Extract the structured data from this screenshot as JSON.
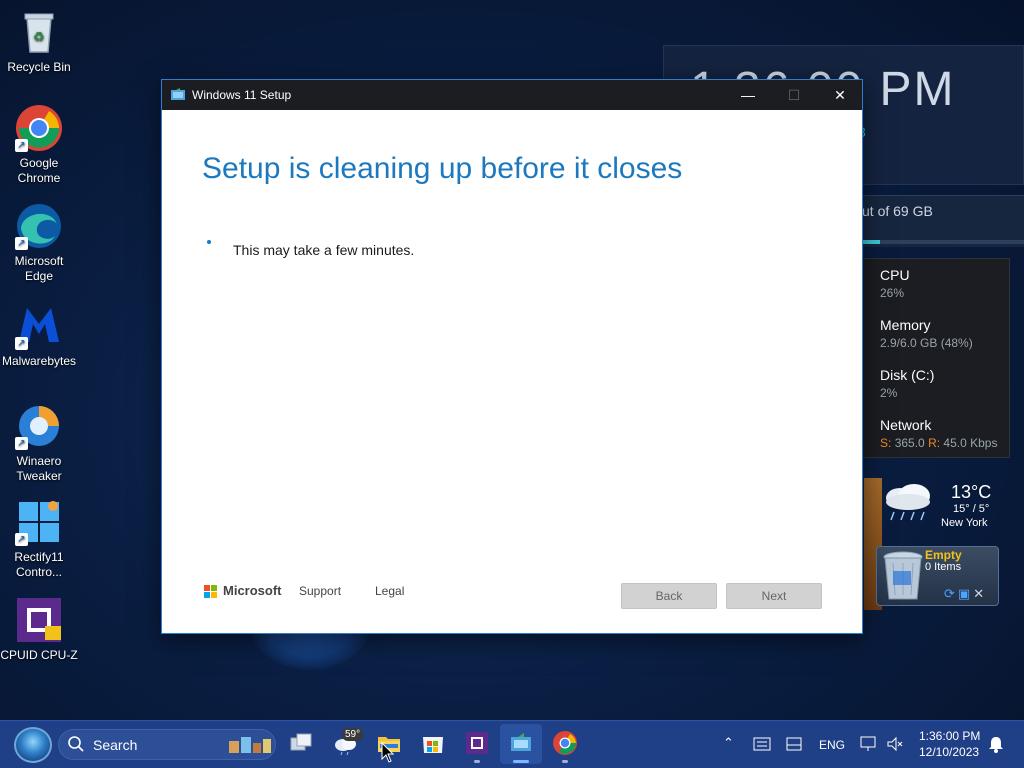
{
  "desktop": {
    "icons": [
      {
        "label": "Recycle Bin",
        "icon": "recycle-bin-icon"
      },
      {
        "label": "Google Chrome",
        "icon": "chrome-icon"
      },
      {
        "label": "Microsoft Edge",
        "icon": "edge-icon"
      },
      {
        "label": "Malwarebytes",
        "icon": "malwarebytes-icon"
      },
      {
        "label": "Winaero Tweaker",
        "icon": "winaero-icon"
      },
      {
        "label": "Rectify11 Contro...",
        "icon": "rectify11-icon"
      },
      {
        "label": "CPUID CPU-Z",
        "icon": "cpuz-icon"
      }
    ]
  },
  "widgets": {
    "clock": {
      "time": "1:36:00 PM",
      "date_fragment": "3"
    },
    "disk": {
      "text": "ut of 69 GB"
    },
    "performance": [
      {
        "name": "CPU",
        "value": "26%"
      },
      {
        "name": "Memory",
        "value": "2.9/6.0 GB (48%)"
      },
      {
        "name": "Disk (C:)",
        "value": "2%"
      },
      {
        "name": "Network",
        "send_label": "S:",
        "send": "365.0",
        "recv_label": "R:",
        "recv": "45.0 Kbps"
      }
    ],
    "weather": {
      "temp": "13°C",
      "range": "15° / 5°",
      "city": "New York"
    },
    "recycle_gadget": {
      "status": "Empty",
      "items": "0 Items"
    }
  },
  "window": {
    "title": "Windows 11 Setup",
    "heading": "Setup is cleaning up before it closes",
    "message": "This may take a few minutes.",
    "footer": {
      "brand": "Microsoft",
      "support": "Support",
      "legal": "Legal",
      "back": "Back",
      "next": "Next"
    }
  },
  "taskbar": {
    "search_label": "Search",
    "weather_badge": "59°",
    "language": "ENG",
    "time": "1:36:00 PM",
    "date": "12/10/2023"
  },
  "colors": {
    "accent": "#1c79c0",
    "taskbar": "#1f3f86",
    "titlebar": "#1b1d22"
  }
}
